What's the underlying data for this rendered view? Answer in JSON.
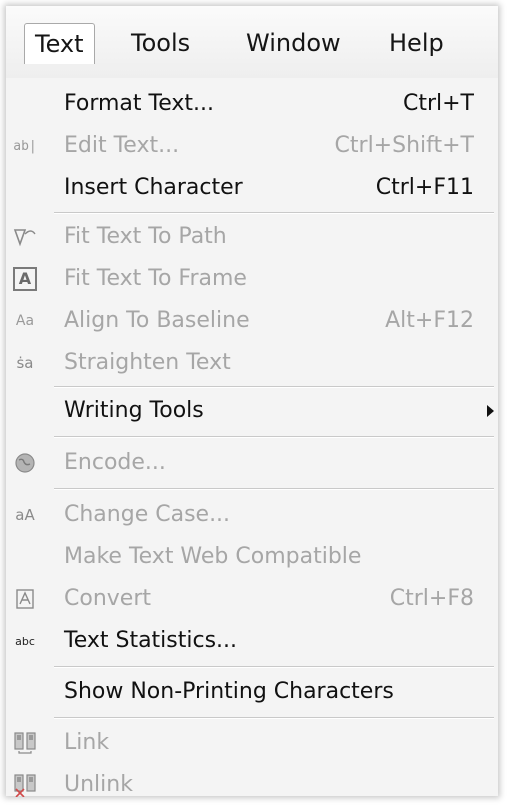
{
  "menubar": {
    "items": [
      {
        "label": "Text",
        "underline": "T"
      },
      {
        "label": "Tools",
        "underline": "o"
      },
      {
        "label": "Window",
        "underline": "W"
      },
      {
        "label": "Help",
        "underline": "H"
      }
    ]
  },
  "menu": {
    "items": [
      {
        "label": "Format Text...",
        "shortcut": "Ctrl+T",
        "enabled": true
      },
      {
        "label": "Edit Text...",
        "shortcut": "Ctrl+Shift+T",
        "enabled": false,
        "icon": "edit-text-icon"
      },
      {
        "label": "Insert Character",
        "shortcut": "Ctrl+F11",
        "enabled": true
      },
      {
        "label": "Fit Text To Path",
        "shortcut": "",
        "enabled": false,
        "icon": "fit-text-to-path-icon"
      },
      {
        "label": "Fit Text To Frame",
        "shortcut": "",
        "enabled": false,
        "icon": "fit-text-to-frame-icon"
      },
      {
        "label": "Align To Baseline",
        "shortcut": "Alt+F12",
        "enabled": false,
        "icon": "align-to-baseline-icon"
      },
      {
        "label": "Straighten Text",
        "shortcut": "",
        "enabled": false,
        "icon": "straighten-text-icon"
      },
      {
        "label": "Writing Tools",
        "shortcut": "",
        "enabled": true,
        "submenu": true
      },
      {
        "label": "Encode...",
        "shortcut": "",
        "enabled": false,
        "icon": "encode-globe-icon"
      },
      {
        "label": "Change Case...",
        "shortcut": "",
        "enabled": false,
        "icon": "change-case-icon"
      },
      {
        "label": "Make Text Web Compatible",
        "shortcut": "",
        "enabled": false
      },
      {
        "label": "Convert",
        "shortcut": "Ctrl+F8",
        "enabled": false,
        "icon": "convert-icon"
      },
      {
        "label": "Text Statistics...",
        "shortcut": "",
        "enabled": true,
        "icon": "text-statistics-icon"
      },
      {
        "label": "Show Non-Printing Characters",
        "shortcut": "",
        "enabled": true
      },
      {
        "label": "Link",
        "shortcut": "",
        "enabled": false,
        "icon": "link-icon"
      },
      {
        "label": "Unlink",
        "shortcut": "",
        "enabled": false,
        "icon": "unlink-icon"
      }
    ]
  },
  "icon_glyphs": {
    "edit_text": "ab|",
    "fit_frame": "A",
    "align_baseline": "Aa",
    "straighten": "ṡa",
    "change_case": "aA",
    "text_stats": "abc"
  }
}
